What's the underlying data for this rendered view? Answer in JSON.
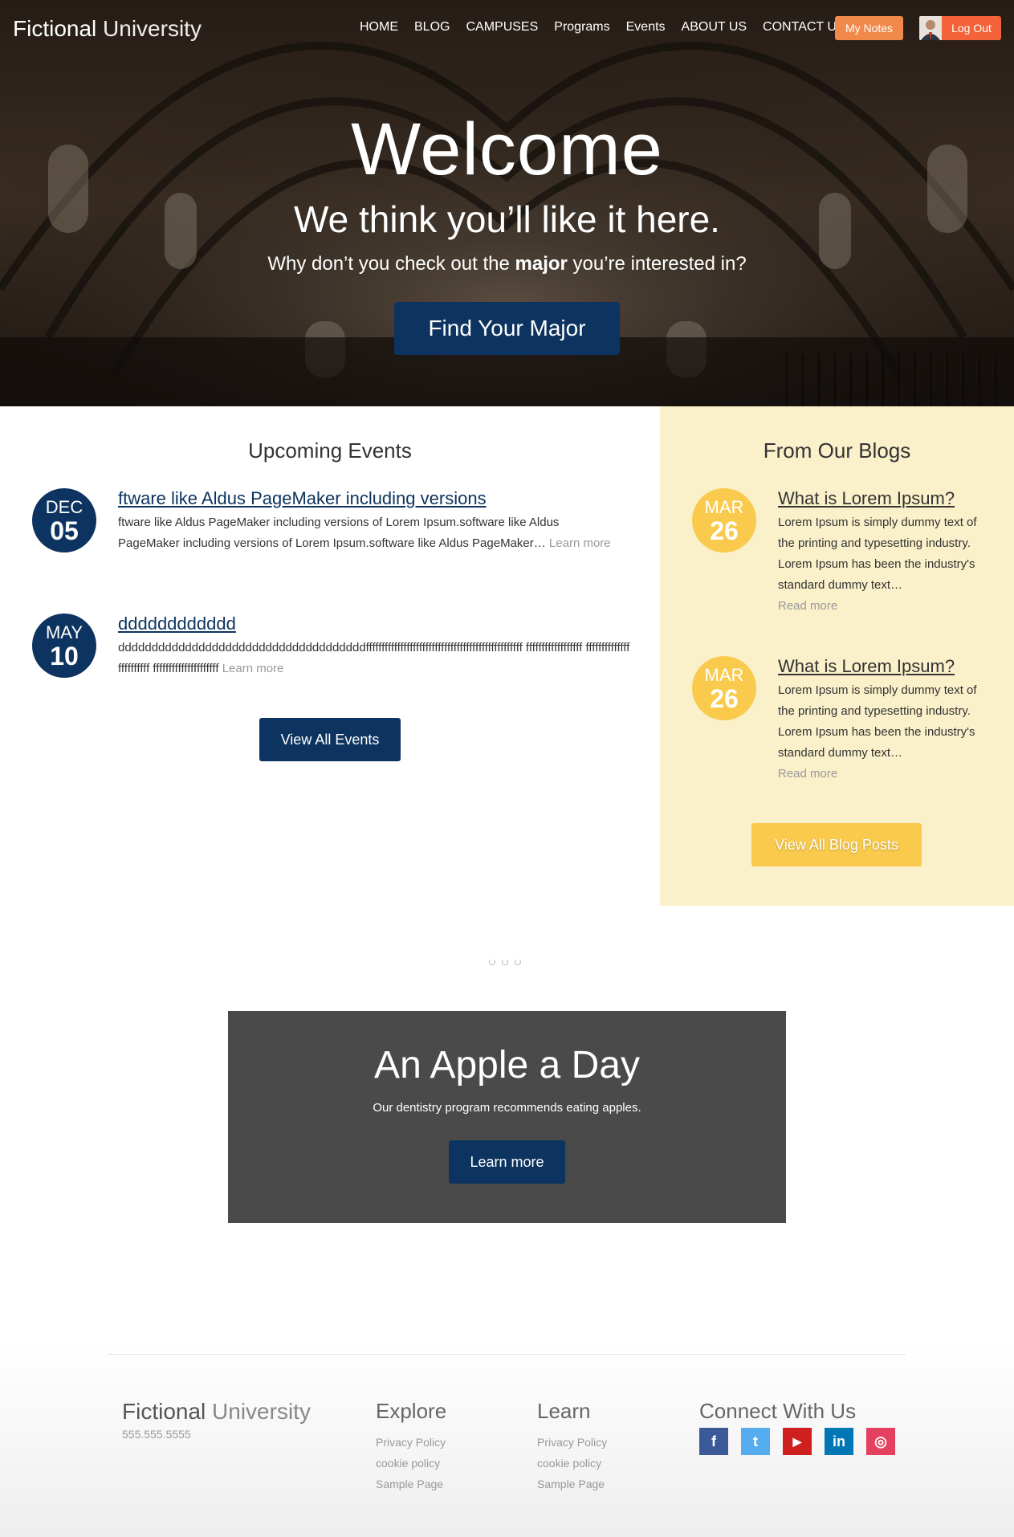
{
  "header": {
    "logo_strong": "Fictional",
    "logo_thin": "University",
    "nav": [
      "HOME",
      "BLOG",
      "CAMPUSES",
      "Programs",
      "Events",
      "ABOUT US",
      "CONTACT US"
    ],
    "my_notes": "My Notes",
    "logout": "Log Out"
  },
  "hero": {
    "title": "Welcome",
    "subtitle": "We think you’ll like it here.",
    "text_before": "Why don’t you check out the",
    "text_bold": "major",
    "text_after": "you’re interested in?",
    "button": "Find Your Major"
  },
  "events": {
    "heading": "Upcoming Events",
    "items": [
      {
        "month": "DEC",
        "day": "05",
        "title": "ftware like Aldus PageMaker including versions",
        "body": "ftware like Aldus PageMaker including versions of Lorem Ipsum.software like Aldus PageMaker including versions of Lorem Ipsum.software like Aldus PageMaker…",
        "more": "Learn more"
      },
      {
        "month": "MAY",
        "day": "10",
        "title": "dddddddddddd",
        "body": "dddddddddddddddddddddddddddddddddddddffffffffffffffffffffffffffffffffffffffffffffffffff ffffffffffffffffff ffffffffffffffffffffffff fffffffffffffffffffff",
        "more": "Learn more"
      }
    ],
    "button": "View All Events"
  },
  "blogs": {
    "heading": "From Our Blogs",
    "items": [
      {
        "month": "MAR",
        "day": "26",
        "title": "What is Lorem Ipsum?",
        "body": "Lorem Ipsum is simply dummy text of the printing and typesetting industry. Lorem Ipsum has been the industry's standard dummy text…",
        "more": "Read more"
      },
      {
        "month": "MAR",
        "day": "26",
        "title": "What is Lorem Ipsum?",
        "body": "Lorem Ipsum is simply dummy text of the printing and typesetting industry. Lorem Ipsum has been the industry's standard dummy text…",
        "more": "Read more"
      }
    ],
    "button": "View All Blog Posts"
  },
  "slide": {
    "title": "An Apple a Day",
    "text": "Our dentistry program recommends eating apples.",
    "button": "Learn more"
  },
  "footer": {
    "logo_strong": "Fictional",
    "logo_thin": "University",
    "phone": "555.555.5555",
    "explore": {
      "heading": "Explore",
      "links": [
        "Privacy Policy",
        "cookie policy",
        "Sample Page"
      ]
    },
    "learn": {
      "heading": "Learn",
      "links": [
        "Privacy Policy",
        "cookie policy",
        "Sample Page"
      ]
    },
    "connect": {
      "heading": "Connect With Us",
      "socials": [
        {
          "name": "facebook-icon",
          "glyph": "f",
          "color": "#3b5998"
        },
        {
          "name": "twitter-icon",
          "glyph": "t",
          "color": "#55acee"
        },
        {
          "name": "youtube-icon",
          "glyph": "▶",
          "color": "#cd201f"
        },
        {
          "name": "linkedin-icon",
          "glyph": "in",
          "color": "#0077b5"
        },
        {
          "name": "instagram-icon",
          "glyph": "◎",
          "color": "#e4405f"
        }
      ]
    }
  },
  "colors": {
    "brand_blue": "#0d3460",
    "brand_yellow": "#f9ca4c",
    "notes_orange": "#f0894a",
    "logout_orange": "#f4623a",
    "blog_bg": "#faf0ca"
  }
}
